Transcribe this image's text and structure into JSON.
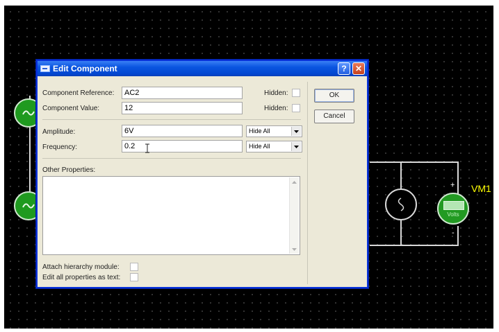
{
  "dialog": {
    "title": "Edit Component",
    "help_label": "?",
    "close_label": "✕",
    "fields": {
      "reference": {
        "label": "Component Reference:",
        "value": "AC2",
        "hidden_label": "Hidden:"
      },
      "value": {
        "label": "Component Value:",
        "value": "12",
        "hidden_label": "Hidden:"
      },
      "amplitude": {
        "label": "Amplitude:",
        "value": "6V",
        "visibility": "Hide All"
      },
      "frequency": {
        "label": "Frequency:",
        "value": "0.2",
        "visibility": "Hide All"
      }
    },
    "other_properties_label": "Other Properties:",
    "attach_hierarchy_label": "Attach hierarchy module:",
    "edit_all_label": "Edit all properties as text:",
    "ok_label": "OK",
    "cancel_label": "Cancel"
  },
  "schematic": {
    "voltmeter_label": "VM1",
    "voltmeter_units": "Volts",
    "plus_sign": "+",
    "minus_sign": "-"
  },
  "icons": {
    "title": "app-icon",
    "dropdown": "chevron-down-icon",
    "scroll_up": "arrow-up-icon",
    "scroll_down": "arrow-down-icon",
    "text_cursor": "i-beam-cursor-icon",
    "sine": "sine-wave-icon"
  },
  "colors": {
    "titlebar": "#0a55e0",
    "dialog_bg": "#ece9d8",
    "canvas_bg": "#000000",
    "source_green": "#1f9a1f",
    "label_yellow": "#ffff00"
  }
}
